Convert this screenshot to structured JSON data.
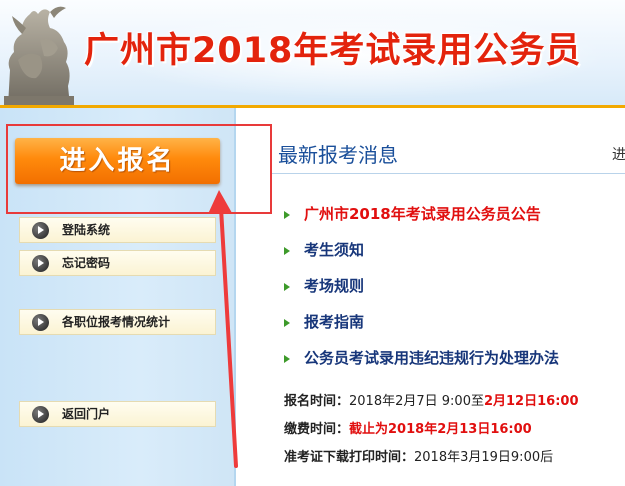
{
  "header": {
    "title": "广州市2018年考试录用公务员"
  },
  "sidebar": {
    "enter_button": "进入报名",
    "items": [
      {
        "label": "登陆系统"
      },
      {
        "label": "忘记密码"
      },
      {
        "label": "各职位报考情况统计"
      },
      {
        "label": "返回门户"
      }
    ]
  },
  "main": {
    "section_title": "最新报考消息",
    "more_link": "进",
    "news": [
      {
        "text": "广州市2018年考试录用公务员公告",
        "highlight": true
      },
      {
        "text": "考生须知",
        "highlight": false
      },
      {
        "text": "考场规则",
        "highlight": false
      },
      {
        "text": "报考指南",
        "highlight": false
      },
      {
        "text": "公务员考试录用违纪违规行为处理办法",
        "highlight": false
      }
    ],
    "info": {
      "signup": {
        "label": "报名时间：",
        "plain": "2018年2月7日 9:00至",
        "emph": "2月12日16:00"
      },
      "fee": {
        "label": "缴费时间：",
        "emph": "截止为2018年2月13日16:00"
      },
      "ticket": {
        "label": "准考证下载打印时间：",
        "plain": "2018年3月19日9:00后"
      }
    }
  },
  "colors": {
    "accent_red": "#e10f0f",
    "link_blue": "#17367a",
    "button_orange": "#ff8a0c",
    "sidebar_blue": "#d9ecfa"
  }
}
